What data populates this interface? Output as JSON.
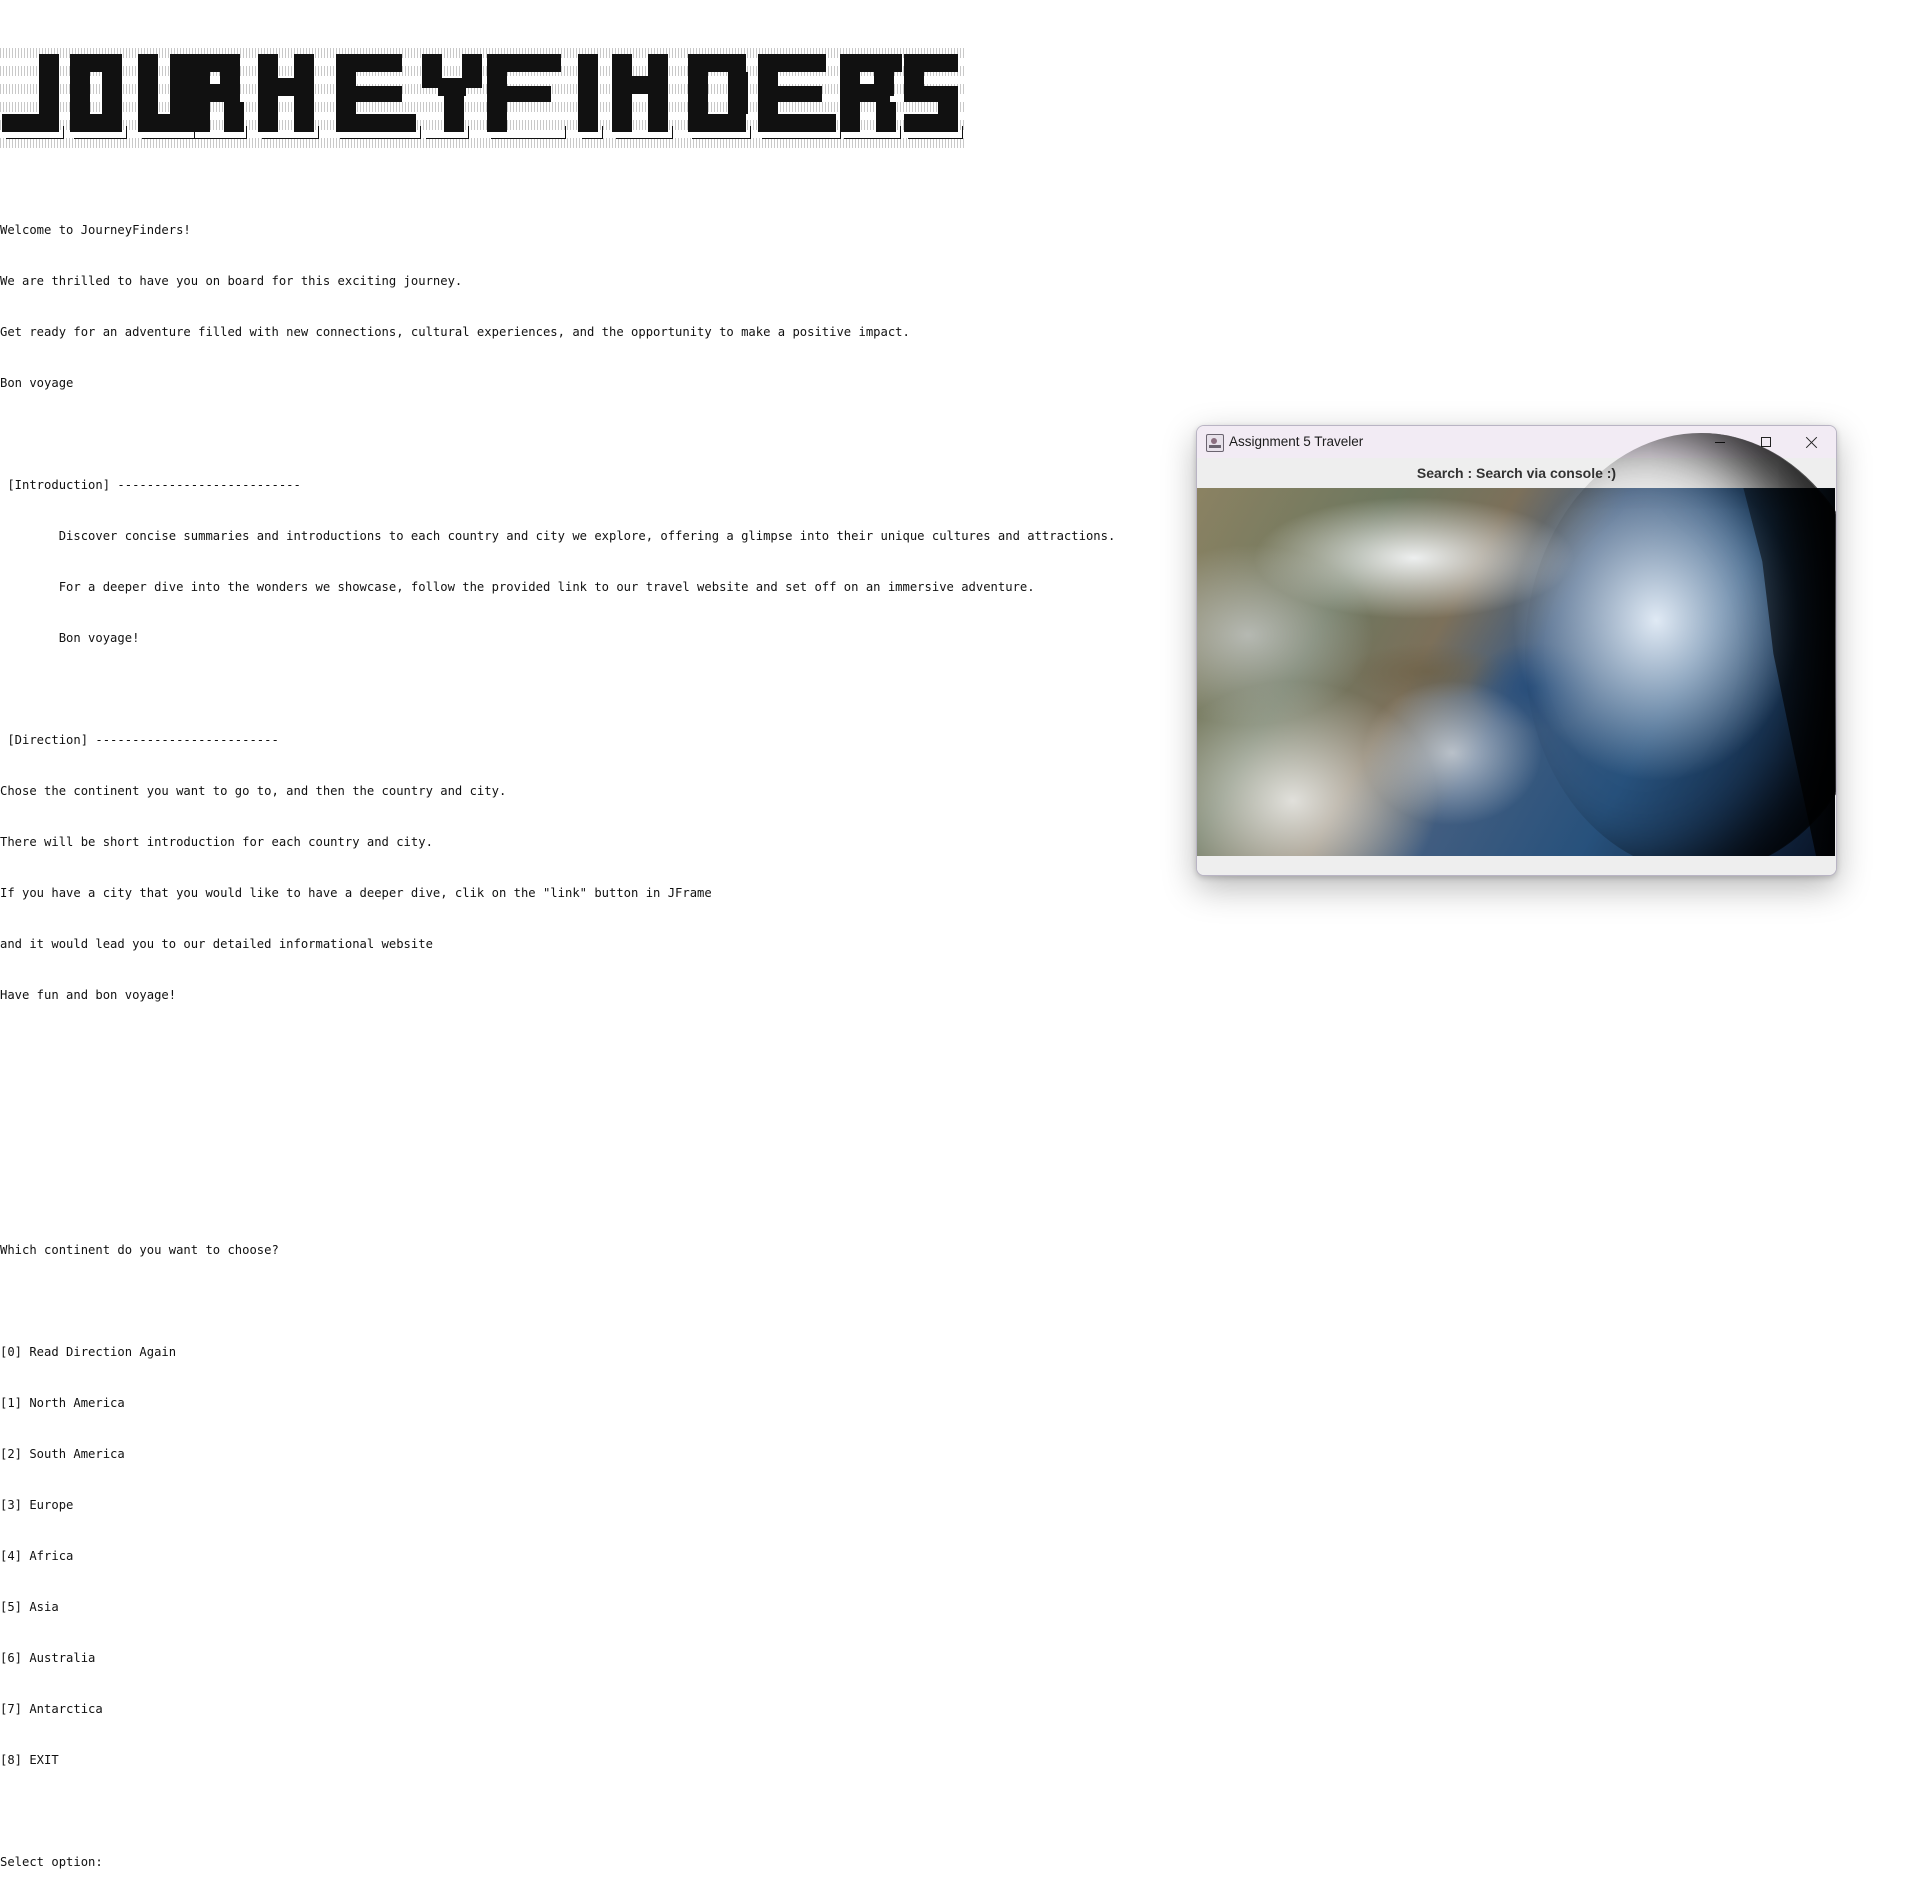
{
  "console": {
    "lines": [
      "Welcome to JourneyFinders!",
      "We are thrilled to have you on board for this exciting journey.",
      "Get ready for an adventure filled with new connections, cultural experiences, and the opportunity to make a positive impact.",
      "Bon voyage",
      "",
      " [Introduction] -------------------------",
      "        Discover concise summaries and introductions to each country and city we explore, offering a glimpse into their unique cultures and attractions.",
      "        For a deeper dive into the wonders we showcase, follow the provided link to our travel website and set off on an immersive adventure.",
      "        Bon voyage!",
      "",
      " [Direction] -------------------------",
      "Chose the continent you want to go to, and then the country and city.",
      "There will be short introduction for each country and city.",
      "If you have a city that you would like to have a deeper dive, clik on the \"link\" button in JFrame",
      "and it would lead you to our detailed informational website",
      "Have fun and bon voyage!",
      "",
      "",
      "",
      "",
      "Which continent do you want to choose?",
      "",
      "[0] Read Direction Again",
      "[1] North America",
      "[2] South America",
      "[3] Europe",
      "[4] Africa",
      "[5] Asia",
      "[6] Australia",
      "[7] Antarctica",
      "[8] EXIT",
      "",
      "Select option:"
    ]
  },
  "window": {
    "title": "Assignment 5 Traveler",
    "search_label": "Search : Search via console :)",
    "icon": "java-app-icon",
    "image": "earth-satellite-image"
  },
  "banner": {
    "icon": "ascii-art-journeyfinders-banner"
  }
}
